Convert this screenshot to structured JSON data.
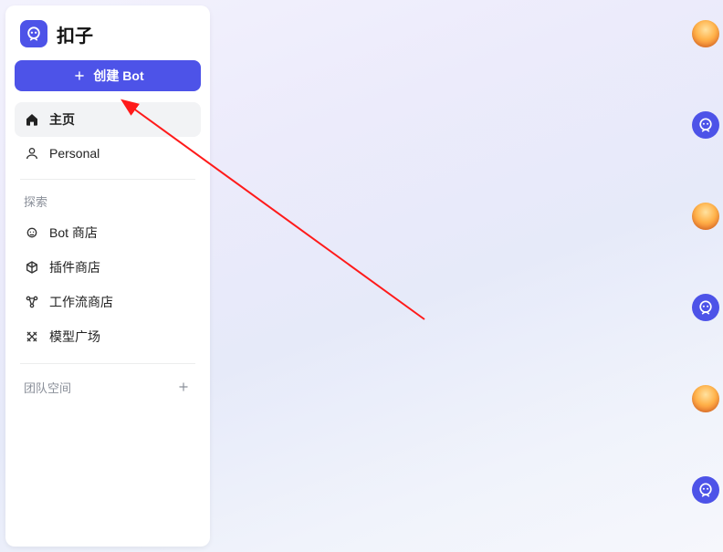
{
  "brand": {
    "title": "扣子"
  },
  "create": {
    "label": "创建 Bot"
  },
  "nav": {
    "home": "主页",
    "personal": "Personal"
  },
  "explore": {
    "label": "探索",
    "bot_store": "Bot 商店",
    "plugin_store": "插件商店",
    "workflow_store": "工作流商店",
    "model_square": "模型广场"
  },
  "team": {
    "label": "团队空间"
  }
}
